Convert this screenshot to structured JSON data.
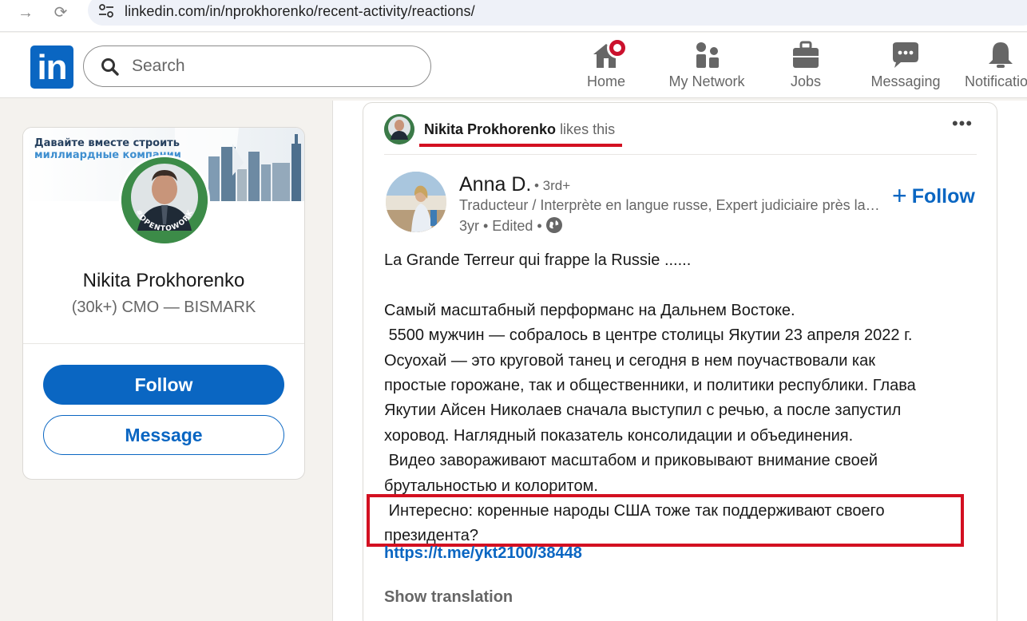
{
  "browser": {
    "url": "linkedin.com/in/nprokhorenko/recent-activity/reactions/"
  },
  "header": {
    "logo": "in",
    "search_placeholder": "Search",
    "nav": [
      {
        "label": "Home",
        "icon": "home-icon"
      },
      {
        "label": "My Network",
        "icon": "network-icon"
      },
      {
        "label": "Jobs",
        "icon": "briefcase-icon"
      },
      {
        "label": "Messaging",
        "icon": "messaging-icon"
      },
      {
        "label": "Notifications",
        "icon": "bell-icon"
      }
    ]
  },
  "profile": {
    "banner_line1": "Давайте вместе строить",
    "banner_line2": "миллиардные компании",
    "avatar_ring_text": "#OPENTOWORK",
    "name": "Nikita Prokhorenko",
    "headline": "(30k+) CMO — BISMARK",
    "follow_label": "Follow",
    "message_label": "Message"
  },
  "post": {
    "actor_name": "Nikita Prokhorenko",
    "actor_action": "likes this",
    "author_name": "Anna D.",
    "author_degree": "• 3rd+",
    "author_title": "Traducteur / Interprète en langue russe, Expert judiciaire près la Cour d'appel",
    "author_meta": "3yr • Edited • ",
    "follow_label": "Follow",
    "body": "La Grande Terreur qui frappe la Russie ......\n\nСамый масштабный перформанс на Дальнем Востоке.\n 5500 мужчин — собралось в центре столицы Якутии 23 апреля 2022 г.\nОсуохай — это круговой танец и сегодня в нем поучаствовали как\nпростые горожане, так и общественники, и политики республики. Глава\nЯкутии Айсен Николаев сначала выступил с речью, а после запустил\nхоровод. Наглядный показатель консолидации и объединения.\n Видео завораживают масштабом и приковывают внимание своей\nбрутальностью и колоритом.\n Интересно: коренные народы США тоже так поддерживают своего\nпрезидента?",
    "link": "https://t.me/ykt2100/38448",
    "show_translation": "Show translation"
  },
  "colors": {
    "brand": "#0a66c2",
    "highlight": "#d31021",
    "notification": "#cb112d"
  }
}
